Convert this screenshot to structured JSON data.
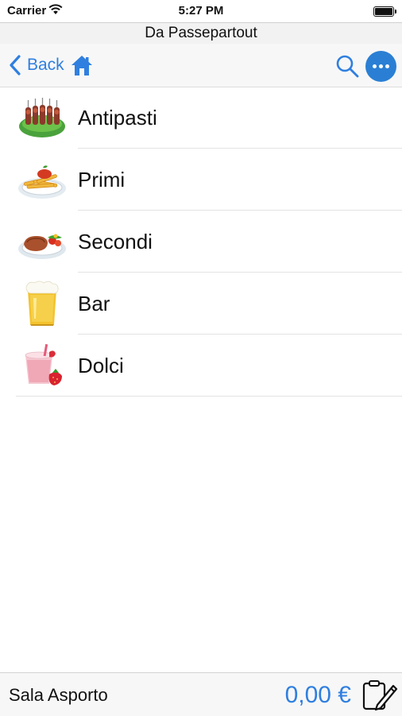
{
  "status_bar": {
    "carrier": "Carrier",
    "time": "5:27 PM"
  },
  "header": {
    "title": "Da Passepartout"
  },
  "nav": {
    "back_label": "Back"
  },
  "menu": {
    "items": [
      {
        "label": "Antipasti",
        "icon": "skewers-icon"
      },
      {
        "label": "Primi",
        "icon": "pasta-icon"
      },
      {
        "label": "Secondi",
        "icon": "steak-icon"
      },
      {
        "label": "Bar",
        "icon": "beer-icon"
      },
      {
        "label": "Dolci",
        "icon": "strawberry-dessert-icon"
      }
    ]
  },
  "footer": {
    "room": "Sala Asporto",
    "total": "0,00 €"
  },
  "colors": {
    "accent": "#2f7fe0",
    "more_button": "#2a7fd4"
  }
}
